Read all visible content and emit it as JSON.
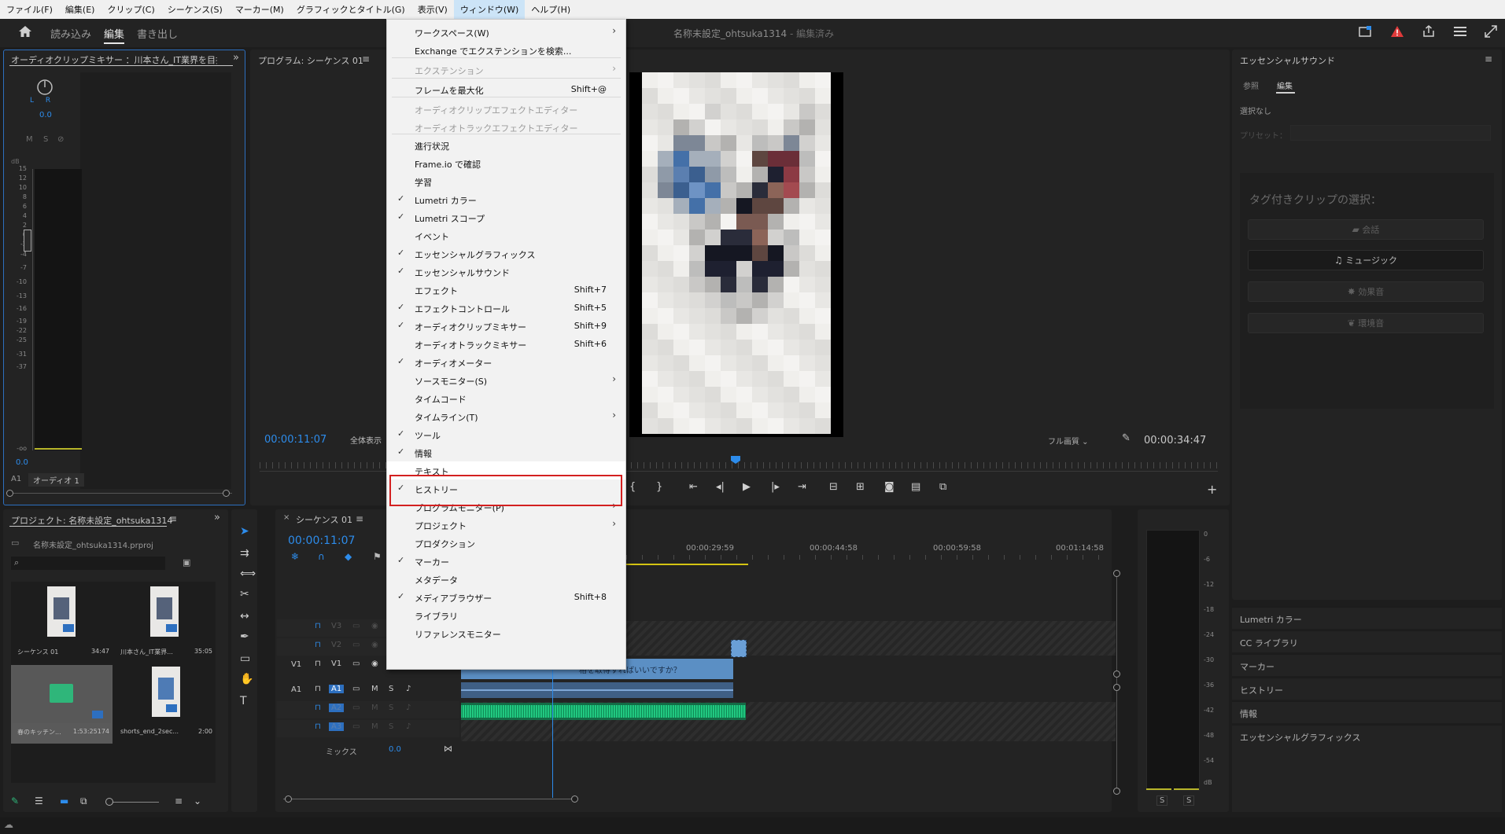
{
  "menubar": [
    "ファイル(F)",
    "編集(E)",
    "クリップ(C)",
    "シーケンス(S)",
    "マーカー(M)",
    "グラフィックとタイトル(G)",
    "表示(V)",
    "ウィンドウ(W)",
    "ヘルプ(H)"
  ],
  "workspace": {
    "tabs": [
      "読み込み",
      "編集",
      "書き出し"
    ],
    "selected": "編集",
    "title": "名称未設定_ohtsuka1314",
    "title_status": " - 編集済み"
  },
  "audio_mixer": {
    "title": "オーディオクリップミキサー ：川本さん_IT業界を目指",
    "value": "0.0",
    "lr": "L R",
    "buttons": [
      "M",
      "S",
      "⊘"
    ],
    "db": "dB",
    "scale": [
      "15",
      "12",
      "10",
      "8",
      "6",
      "4",
      "2",
      "0",
      "-2",
      "-4",
      "-7",
      "-10",
      "-13",
      "-16",
      "-19",
      "-22",
      "-25",
      "-31",
      "-37",
      "-oo"
    ],
    "bottom_value": "0.0",
    "channel": "A1",
    "channel_name": "オーディオ 1"
  },
  "program": {
    "title": "プログラム: シーケンス 01",
    "timecode": "00:00:11:07",
    "fit": "全体表示",
    "quality": "フル画質",
    "duration": "00:00:34:47"
  },
  "window_menu": {
    "items": [
      {
        "label": "ワークスペース(W)",
        "check": false,
        "shortcut": "",
        "submenu": true,
        "disabled": false
      },
      {
        "label": "Exchange でエクステンションを検索...",
        "check": false,
        "shortcut": "",
        "submenu": false,
        "disabled": false
      },
      {
        "label": "エクステンション",
        "check": false,
        "shortcut": "",
        "submenu": true,
        "disabled": true
      },
      {
        "label": "フレームを最大化",
        "check": false,
        "shortcut": "Shift+@",
        "submenu": false,
        "disabled": false
      },
      {
        "label": "オーディオクリップエフェクトエディター",
        "check": false,
        "shortcut": "",
        "submenu": false,
        "disabled": true
      },
      {
        "label": "オーディオトラックエフェクトエディター",
        "check": false,
        "shortcut": "",
        "submenu": false,
        "disabled": true
      },
      {
        "label": "進行状況",
        "check": false,
        "shortcut": "",
        "submenu": false,
        "disabled": false
      },
      {
        "label": "Frame.io で確認",
        "check": false,
        "shortcut": "",
        "submenu": false,
        "disabled": false
      },
      {
        "label": "学習",
        "check": false,
        "shortcut": "",
        "submenu": false,
        "disabled": false
      },
      {
        "label": "Lumetri カラー",
        "check": true,
        "shortcut": "",
        "submenu": false,
        "disabled": false
      },
      {
        "label": "Lumetri スコープ",
        "check": true,
        "shortcut": "",
        "submenu": false,
        "disabled": false
      },
      {
        "label": "イベント",
        "check": false,
        "shortcut": "",
        "submenu": false,
        "disabled": false
      },
      {
        "label": "エッセンシャルグラフィックス",
        "check": true,
        "shortcut": "",
        "submenu": false,
        "disabled": false
      },
      {
        "label": "エッセンシャルサウンド",
        "check": true,
        "shortcut": "",
        "submenu": false,
        "disabled": false
      },
      {
        "label": "エフェクト",
        "check": false,
        "shortcut": "Shift+7",
        "submenu": false,
        "disabled": false
      },
      {
        "label": "エフェクトコントロール",
        "check": true,
        "shortcut": "Shift+5",
        "submenu": false,
        "disabled": false
      },
      {
        "label": "オーディオクリップミキサー",
        "check": true,
        "shortcut": "Shift+9",
        "submenu": false,
        "disabled": false
      },
      {
        "label": "オーディオトラックミキサー",
        "check": false,
        "shortcut": "Shift+6",
        "submenu": false,
        "disabled": false
      },
      {
        "label": "オーディオメーター",
        "check": true,
        "shortcut": "",
        "submenu": false,
        "disabled": false
      },
      {
        "label": "ソースモニター(S)",
        "check": false,
        "shortcut": "",
        "submenu": true,
        "disabled": false
      },
      {
        "label": "タイムコード",
        "check": false,
        "shortcut": "",
        "submenu": false,
        "disabled": false
      },
      {
        "label": "タイムライン(T)",
        "check": false,
        "shortcut": "",
        "submenu": true,
        "disabled": false
      },
      {
        "label": "ツール",
        "check": true,
        "shortcut": "",
        "submenu": false,
        "disabled": false
      },
      {
        "label": "情報",
        "check": true,
        "shortcut": "",
        "submenu": false,
        "disabled": false
      },
      {
        "label": "テキスト",
        "check": false,
        "shortcut": "",
        "submenu": false,
        "disabled": false
      },
      {
        "label": "ヒストリー",
        "check": true,
        "shortcut": "",
        "submenu": false,
        "disabled": false
      },
      {
        "label": "プログラムモニター(P)",
        "check": false,
        "shortcut": "",
        "submenu": true,
        "disabled": false
      },
      {
        "label": "プロジェクト",
        "check": false,
        "shortcut": "",
        "submenu": true,
        "disabled": false
      },
      {
        "label": "プロダクション",
        "check": false,
        "shortcut": "",
        "submenu": false,
        "disabled": false
      },
      {
        "label": "マーカー",
        "check": true,
        "shortcut": "",
        "submenu": false,
        "disabled": false
      },
      {
        "label": "メタデータ",
        "check": false,
        "shortcut": "",
        "submenu": false,
        "disabled": false
      },
      {
        "label": "メディアブラウザー",
        "check": true,
        "shortcut": "Shift+8",
        "submenu": false,
        "disabled": false
      },
      {
        "label": "ライブラリ",
        "check": false,
        "shortcut": "",
        "submenu": false,
        "disabled": false
      },
      {
        "label": "リファレンスモニター",
        "check": false,
        "shortcut": "",
        "submenu": false,
        "disabled": false
      }
    ],
    "highlighted": "テキスト"
  },
  "project": {
    "title": "プロジェクト: 名称未設定_ohtsuka1314",
    "file": "名称未設定_ohtsuka1314.prproj",
    "items": [
      {
        "name": "シーケンス 01",
        "duration": "34:47"
      },
      {
        "name": "川本さん_IT業界...",
        "duration": "35:05"
      },
      {
        "name": "春のキッチン...",
        "duration": "1:53:25174"
      },
      {
        "name": "shorts_end_2sec...",
        "duration": "2:00"
      }
    ]
  },
  "timeline": {
    "title": "シーケンス 01",
    "timecode": "00:00:11:07",
    "ruler": [
      "00:00:29:59",
      "00:00:44:58",
      "00:00:59:58",
      "00:01:14:58"
    ],
    "tracks": [
      "V3",
      "V2",
      "V1",
      "A1",
      "A2",
      "A3"
    ],
    "source_v": "V1",
    "source_a": "A1",
    "mix_label": "ミックス",
    "mix_value": "0.0",
    "clip_text": "格を取得すればいいですか？"
  },
  "meter": {
    "scale": [
      "0",
      "-6",
      "-12",
      "-18",
      "-24",
      "-30",
      "-36",
      "-42",
      "-48",
      "-54",
      "dB"
    ],
    "solo": [
      "S",
      "S"
    ]
  },
  "essential_sound": {
    "title": "エッセンシャルサウンド",
    "tabs": [
      "参照",
      "編集"
    ],
    "selected_tab": "編集",
    "selection": "選択なし",
    "preset_label": "プリセット：",
    "prompt": "タグ付きクリップの選択：",
    "buttons": [
      "会話",
      "ミュージック",
      "効果音",
      "環境音"
    ]
  },
  "right_panels": [
    "Lumetri カラー",
    "CC ライブラリ",
    "マーカー",
    "ヒストリー",
    "情報",
    "エッセンシャルグラフィックス"
  ],
  "colors": {
    "accent": "#2d8ceb",
    "highlight_box": "#d32020",
    "waveform": "#1fbf7a"
  }
}
